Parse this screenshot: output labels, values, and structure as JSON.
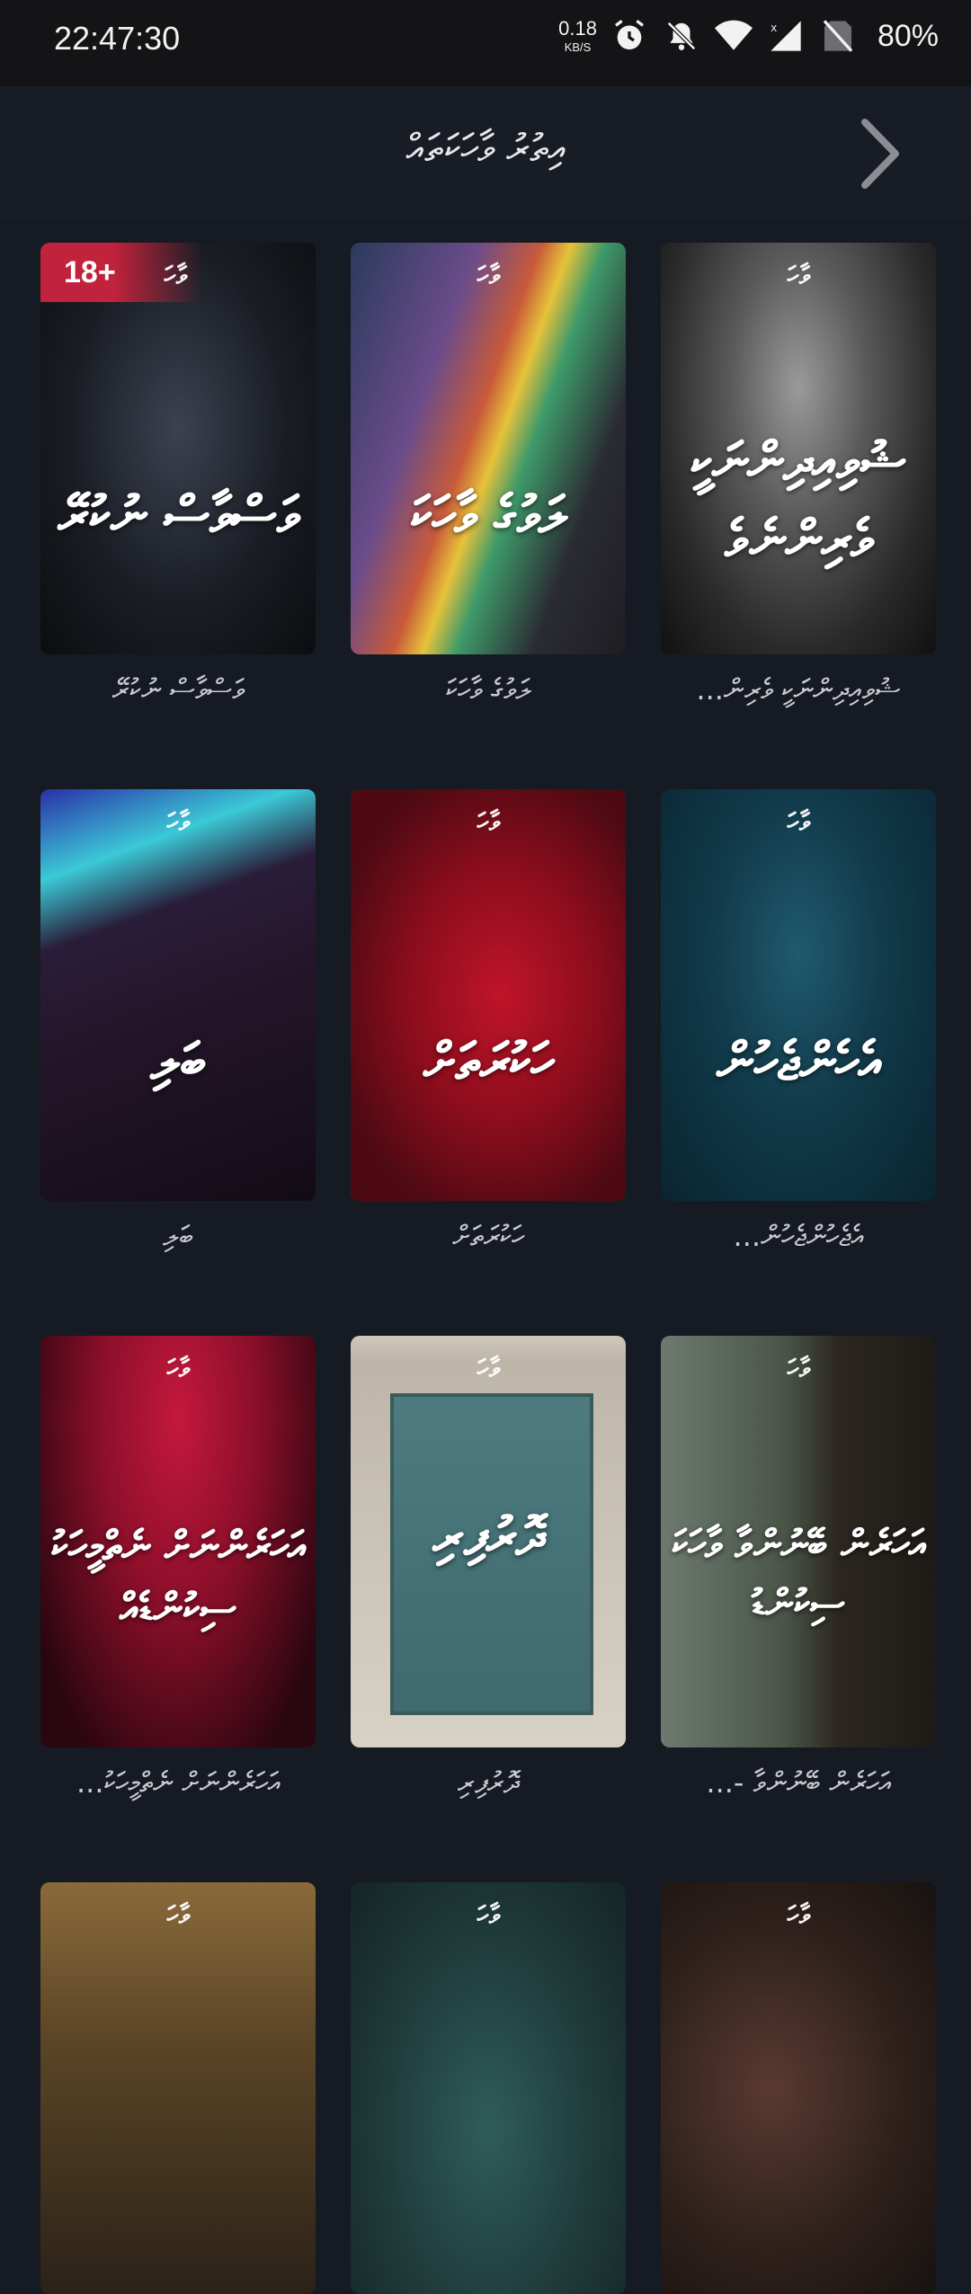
{
  "status_bar": {
    "time": "22:47:30",
    "net_speed_value": "0.18",
    "net_speed_unit": "KB/S",
    "battery": "80%"
  },
  "header": {
    "title": "އިތުރު ވާހަކަތައް"
  },
  "cards": [
    {
      "overlay": "ވަސްވާސް ނުކުރޭ",
      "caption": "ވަސްވާސް ނުކުރޭ",
      "badge": "18+"
    },
    {
      "overlay": "ލަވުގެ ވާހަކަ",
      "caption": "ލަވުގެ ވާހަކަ"
    },
    {
      "overlay": "ޝުވިއިދިންނަކީ ވެރިންނެވެ",
      "caption": "ޝުވިއިދިންނަކީ ވެރިން..."
    },
    {
      "overlay": "ބަލި",
      "caption": "ބަލި"
    },
    {
      "overlay": "ހަކުރަތަށް",
      "caption": "ހަކުރަތަށް"
    },
    {
      "overlay": "އެހެންޖެހުން",
      "caption": "އެޖެހުންޖެހުން..."
    },
    {
      "overlay": "އަހަރެންނަށް ނެތްމީހަކު ސިކުންޑެއް",
      "caption": "އަހަރެންނަށް ނެތްމީހަކު..."
    },
    {
      "overlay": "ދޮރުފިރި",
      "caption": "ދޮރުފިރި"
    },
    {
      "overlay": "އަހަރެން ބޭނުންވާ ވާހަކަ ސިކުންޑު",
      "caption": "އަހަރެން ބޭނުންވާ -..."
    },
    {
      "overlay": "",
      "caption": ""
    },
    {
      "overlay": "",
      "caption": ""
    },
    {
      "overlay": "",
      "caption": ""
    }
  ],
  "colors": {
    "background": "#161a23",
    "badge": "#c2233c"
  },
  "icons": [
    "alarm-icon",
    "bell-off-icon",
    "wifi-icon",
    "signal-icon",
    "no-sim-icon",
    "chevron-right-icon"
  ]
}
